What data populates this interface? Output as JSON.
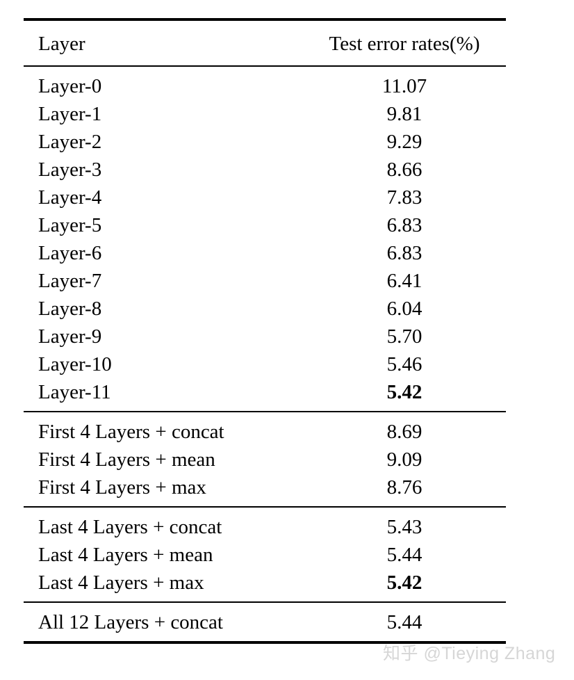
{
  "table": {
    "columns": [
      {
        "key": "layer",
        "label": "Layer",
        "align": "left"
      },
      {
        "key": "value",
        "label": "Test error rates(%)",
        "align": "center"
      }
    ],
    "groups": [
      {
        "rows": [
          {
            "layer": "Layer-0",
            "value": "11.07",
            "bold": false
          },
          {
            "layer": "Layer-1",
            "value": "9.81",
            "bold": false
          },
          {
            "layer": "Layer-2",
            "value": "9.29",
            "bold": false
          },
          {
            "layer": "Layer-3",
            "value": "8.66",
            "bold": false
          },
          {
            "layer": "Layer-4",
            "value": "7.83",
            "bold": false
          },
          {
            "layer": "Layer-5",
            "value": "6.83",
            "bold": false
          },
          {
            "layer": "Layer-6",
            "value": "6.83",
            "bold": false
          },
          {
            "layer": "Layer-7",
            "value": "6.41",
            "bold": false
          },
          {
            "layer": "Layer-8",
            "value": "6.04",
            "bold": false
          },
          {
            "layer": "Layer-9",
            "value": "5.70",
            "bold": false
          },
          {
            "layer": "Layer-10",
            "value": "5.46",
            "bold": false
          },
          {
            "layer": "Layer-11",
            "value": "5.42",
            "bold": true
          }
        ]
      },
      {
        "rows": [
          {
            "layer": "First 4 Layers + concat",
            "value": "8.69",
            "bold": false
          },
          {
            "layer": "First 4 Layers + mean",
            "value": "9.09",
            "bold": false
          },
          {
            "layer": "First 4 Layers + max",
            "value": "8.76",
            "bold": false
          }
        ]
      },
      {
        "rows": [
          {
            "layer": "Last 4 Layers + concat",
            "value": "5.43",
            "bold": false
          },
          {
            "layer": "Last 4 Layers + mean",
            "value": "5.44",
            "bold": false
          },
          {
            "layer": "Last 4 Layers + max",
            "value": "5.42",
            "bold": true
          }
        ]
      },
      {
        "rows": [
          {
            "layer": "All 12 Layers + concat",
            "value": "5.44",
            "bold": false
          }
        ]
      }
    ]
  },
  "watermark": {
    "text": "知乎 @Tieying Zhang",
    "color": "#d6d6d6"
  }
}
